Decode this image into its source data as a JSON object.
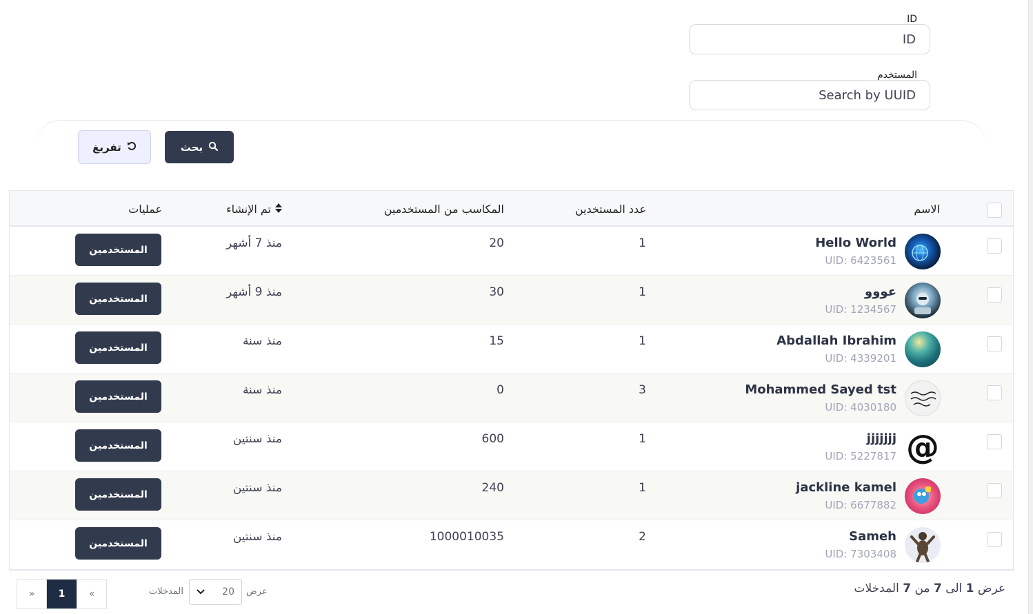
{
  "filters": {
    "id_label": "ID",
    "id_placeholder": "ID",
    "user_label": "المستخدم",
    "user_placeholder": "Search by  UUID",
    "search_button": "بحث",
    "reset_button": "تفريغ"
  },
  "table": {
    "headers": {
      "name": "الاسم",
      "users_count": "عدد المستخدين",
      "earnings": "المكاسب من المستخدمين",
      "created": "تم الإنشاء",
      "actions": "عمليات"
    },
    "rows": [
      {
        "name": "Hello World",
        "uid": "UID: 6423561",
        "users_count": "1",
        "earnings": "20",
        "created": "منذ 7 أشهر",
        "action": "المستخدمين",
        "avatar": "globe-avatar"
      },
      {
        "name": "عووو",
        "uid": "UID: 1234567",
        "users_count": "1",
        "earnings": "30",
        "created": "منذ 9 أشهر",
        "action": "المستخدمين",
        "avatar": "robot-avatar"
      },
      {
        "name": "Abdallah Ibrahim",
        "uid": "UID: 4339201",
        "users_count": "1",
        "earnings": "15",
        "created": "منذ سنة",
        "action": "المستخدمين",
        "avatar": "water-avatar"
      },
      {
        "name": "Mohammed Sayed tst",
        "uid": "UID: 4030180",
        "users_count": "3",
        "earnings": "0",
        "created": "منذ سنة",
        "action": "المستخدمين",
        "avatar": "calligraphy-avatar"
      },
      {
        "name": "jjjjjjj",
        "uid": "UID: 5227817",
        "users_count": "1",
        "earnings": "600",
        "created": "منذ سنتين",
        "action": "المستخدمين",
        "avatar": "at-sign-avatar"
      },
      {
        "name": "jackline kamel",
        "uid": "UID: 6677882",
        "users_count": "1",
        "earnings": "240",
        "created": "منذ سنتين",
        "action": "المستخدمين",
        "avatar": "cartoon-avatar"
      },
      {
        "name": "Sameh",
        "uid": "UID: 7303408",
        "users_count": "2",
        "earnings": "1000010035",
        "created": "منذ سنتين",
        "action": "المستخدمين",
        "avatar": "bear-avatar"
      }
    ]
  },
  "pagination": {
    "prev": "«",
    "current": "1",
    "next": "»",
    "per_page_prefix": "عرض",
    "per_page_value": "20",
    "per_page_suffix": "المدخلات",
    "summary": {
      "prefix": "عرض",
      "from": "1",
      "to_word": "الى",
      "to": "7",
      "of_word": "من",
      "total": "7",
      "suffix": "المدخلات"
    }
  },
  "colors": {
    "primary_dark": "#323b4e",
    "pager_active": "#1f2d44",
    "reset_bg": "#eef0ff"
  }
}
